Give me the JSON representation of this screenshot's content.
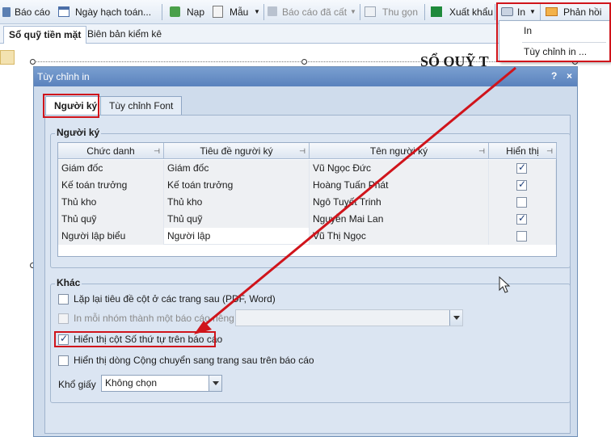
{
  "toolbar": {
    "bao_cao": "Báo cáo",
    "ngay_hach_toan": "Ngày hạch toán...",
    "nap": "Nạp",
    "mau": "Mẫu",
    "bao_cao_da_cat": "Báo cáo đã cất",
    "thu_gon": "Thu gọn",
    "xuat_khau": "Xuất khẩu",
    "in": "In",
    "phan_hoi": "Phản hồi"
  },
  "print_menu": {
    "items": [
      "In",
      "Tùy chỉnh in ..."
    ]
  },
  "tabs": [
    "Sổ quỹ tiền mặt",
    "Biên bản kiểm kê"
  ],
  "report": {
    "title_fragment": "SỔ QUỸ T"
  },
  "dialog": {
    "title": "Tùy chỉnh in",
    "help": "?",
    "close": "×",
    "tabs": [
      "Người ký",
      "Tùy chỉnh Font"
    ],
    "signers_group": "Người ký",
    "columns": [
      "Chức danh",
      "Tiêu đề người ký",
      "Tên người ký",
      "Hiển thị"
    ],
    "rows": [
      {
        "chuc_danh": "Giám đốc",
        "tieu_de": "Giám đốc",
        "ten": "Vũ Ngọc Đức",
        "hien_thi": true
      },
      {
        "chuc_danh": "Kế toán trưởng",
        "tieu_de": "Kế toán trưởng",
        "ten": "Hoàng Tuấn Phát",
        "hien_thi": true
      },
      {
        "chuc_danh": "Thủ kho",
        "tieu_de": "Thủ kho",
        "ten": "Ngô Tuyết Trinh",
        "hien_thi": false
      },
      {
        "chuc_danh": "Thủ quỹ",
        "tieu_de": "Thủ quỹ",
        "ten": "Nguyễn Mai Lan",
        "hien_thi": true
      },
      {
        "chuc_danh": "Người lập biểu",
        "tieu_de": "Người lập",
        "ten": "Vũ Thị Ngọc",
        "hien_thi": false
      }
    ],
    "other_group": "Khác",
    "options": {
      "repeat_header": "Lặp lại tiêu đề cột ở các trang sau (PDF, Word)",
      "print_each_group": "In mỗi nhóm thành một báo cáo riêng",
      "show_stt": "Hiển thị cột Số thứ tự trên báo cáo",
      "show_carry": "Hiển thị dòng Cộng chuyển sang trang sau trên báo cáo"
    },
    "paper_label": "Khổ giấy",
    "paper_value": "Không chọn"
  }
}
